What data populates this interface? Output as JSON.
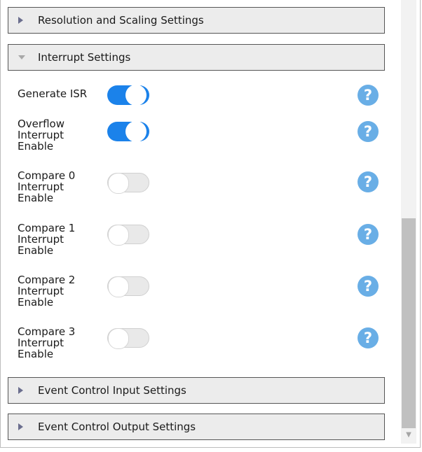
{
  "sections": {
    "resolution": {
      "label": "Resolution and Scaling Settings",
      "expanded": false
    },
    "interrupt": {
      "label": "Interrupt Settings",
      "expanded": true
    },
    "event_input": {
      "label": "Event Control Input Settings",
      "expanded": false
    },
    "event_output": {
      "label": "Event Control Output Settings",
      "expanded": false
    }
  },
  "rows": [
    {
      "lines": [
        "Generate ISR"
      ],
      "on": true
    },
    {
      "lines": [
        "Overflow",
        "Interrupt",
        "Enable"
      ],
      "on": true
    },
    {
      "lines": [
        "Compare 0",
        "Interrupt",
        "Enable"
      ],
      "on": false
    },
    {
      "lines": [
        "Compare 1",
        "Interrupt",
        "Enable"
      ],
      "on": false
    },
    {
      "lines": [
        "Compare 2",
        "Interrupt",
        "Enable"
      ],
      "on": false
    },
    {
      "lines": [
        "Compare 3",
        "Interrupt",
        "Enable"
      ],
      "on": false
    }
  ],
  "help_glyph": "?",
  "colors": {
    "toggle_on": "#1b82ea",
    "help": "#69aee6"
  },
  "icons": {
    "collapsed": "caret-right-icon",
    "expanded": "caret-down-icon",
    "help": "help-icon"
  }
}
